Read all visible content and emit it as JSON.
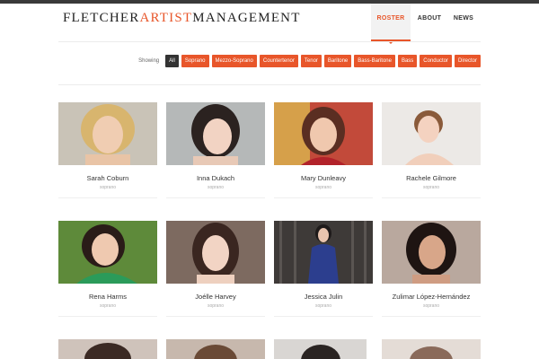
{
  "brand": {
    "part1": "FLETCHER",
    "part2": "ARTIST",
    "part3": "MANAGEMENT"
  },
  "nav": {
    "roster": "ROSTER",
    "about": "ABOUT",
    "news": "NEWS"
  },
  "filters": {
    "showing_label": "Showing",
    "items": [
      "All",
      "Soprano",
      "Mezzo-Soprano",
      "Countertenor",
      "Tenor",
      "Baritone",
      "Bass-Baritone",
      "Bass",
      "Conductor",
      "Director"
    ]
  },
  "artists": [
    {
      "name": "Sarah Coburn",
      "voice": "soprano"
    },
    {
      "name": "Inna Dukach",
      "voice": "soprano"
    },
    {
      "name": "Mary Dunleavy",
      "voice": "soprano"
    },
    {
      "name": "Rachele Gilmore",
      "voice": "soprano"
    },
    {
      "name": "Rena Harms",
      "voice": "soprano"
    },
    {
      "name": "Joélle Harvey",
      "voice": "soprano"
    },
    {
      "name": "Jessica Julin",
      "voice": "soprano"
    },
    {
      "name": "Zulimar López-Hernández",
      "voice": "soprano"
    }
  ],
  "colors": {
    "accent": "#e8562a",
    "active_filter": "#333333"
  }
}
